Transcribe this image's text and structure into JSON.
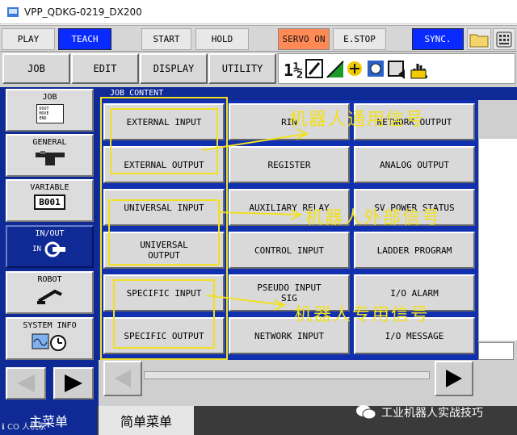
{
  "window": {
    "title": "VPP_QDKG-0219_DX200"
  },
  "topbar": {
    "play": "PLAY",
    "teach": "TEACH",
    "start": "START",
    "hold": "HOLD",
    "servo_on": "SERVO ON",
    "estop": "E.STOP",
    "sync": "SYNC."
  },
  "menu": {
    "job": "JOB",
    "edit": "EDIT",
    "display": "DISPLAY",
    "utility": "UTILITY"
  },
  "left_menu": {
    "job": {
      "label": "JOB",
      "doc_lines": [
        "DOUT",
        "MOVE",
        "END"
      ]
    },
    "general": {
      "label": "GENERAL"
    },
    "variable": {
      "label": "VARIABLE",
      "badge": "B001"
    },
    "inout": {
      "label": "IN/OUT",
      "sub": "IN"
    },
    "robot": {
      "label": "ROBOT"
    },
    "system_info": {
      "label": "SYSTEM INFO"
    }
  },
  "content": {
    "header": "JOB CONTENT",
    "buttons": {
      "r0": [
        "EXTERNAL INPUT",
        "RIN",
        "NETWORK OUTPUT"
      ],
      "r1": [
        "EXTERNAL OUTPUT",
        "REGISTER",
        "ANALOG OUTPUT"
      ],
      "r2": [
        "UNIVERSAL INPUT",
        "AUXILIARY RELAY",
        "SV POWER STATUS"
      ],
      "r3": [
        "UNIVERSAL\nOUTPUT",
        "CONTROL INPUT",
        "LADDER PROGRAM"
      ],
      "r4": [
        "SPECIFIC INPUT",
        "PSEUDO INPUT\nSIG",
        "I/O ALARM"
      ],
      "r5": [
        "SPECIFIC OUTPUT",
        "NETWORK INPUT",
        "I/O MESSAGE"
      ]
    }
  },
  "annotations": {
    "general": "机器人通用信号",
    "external": "机器人外部信号",
    "dedicated": "机器人专用信号"
  },
  "bottom_tabs": {
    "main_menu": "主菜单",
    "simple_menu": "简单菜单"
  },
  "watermark": {
    "text": "工业机器人实战技巧",
    "corner": "ℹ CO 人机家"
  },
  "colors": {
    "teach_active": "#0a2bff",
    "servo_on": "#ff8a55",
    "sync": "#0a2bff",
    "panel_blue": "#0f2a95",
    "annotation": "#f0e020"
  }
}
